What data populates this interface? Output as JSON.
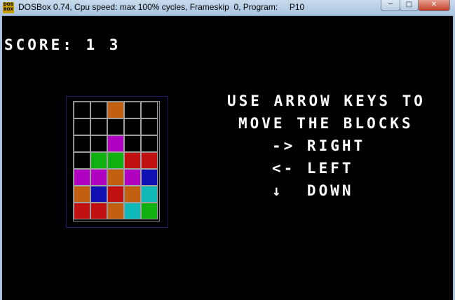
{
  "window": {
    "icon_text": "DOS BOX",
    "title": "DOSBox 0.74, Cpu speed: max 100% cycles, Frameskip  0, Program:     P10",
    "minimize": "─",
    "maximize": "□",
    "close": "✕"
  },
  "game": {
    "score_text": "SCORE: 1 3",
    "instructions": [
      "USE ARROW KEYS TO",
      "MOVE THE BLOCKS",
      "-> RIGHT",
      "<- LEFT",
      "↓  DOWN"
    ],
    "colors": {
      "empty": "#000000",
      "orange": "#c06010",
      "magenta": "#b000c0",
      "green": "#10b010",
      "red": "#c01010",
      "blue": "#1010b0",
      "cyan": "#10b8b8"
    },
    "board": [
      [
        "empty",
        "empty",
        "orange",
        "empty",
        "empty"
      ],
      [
        "empty",
        "empty",
        "empty",
        "empty",
        "empty"
      ],
      [
        "empty",
        "empty",
        "magenta",
        "empty",
        "empty"
      ],
      [
        "empty",
        "green",
        "green",
        "red",
        "red"
      ],
      [
        "magenta",
        "magenta",
        "orange",
        "magenta",
        "blue"
      ],
      [
        "orange",
        "blue",
        "red",
        "orange",
        "cyan"
      ],
      [
        "red",
        "red",
        "orange",
        "cyan",
        "green"
      ]
    ]
  }
}
